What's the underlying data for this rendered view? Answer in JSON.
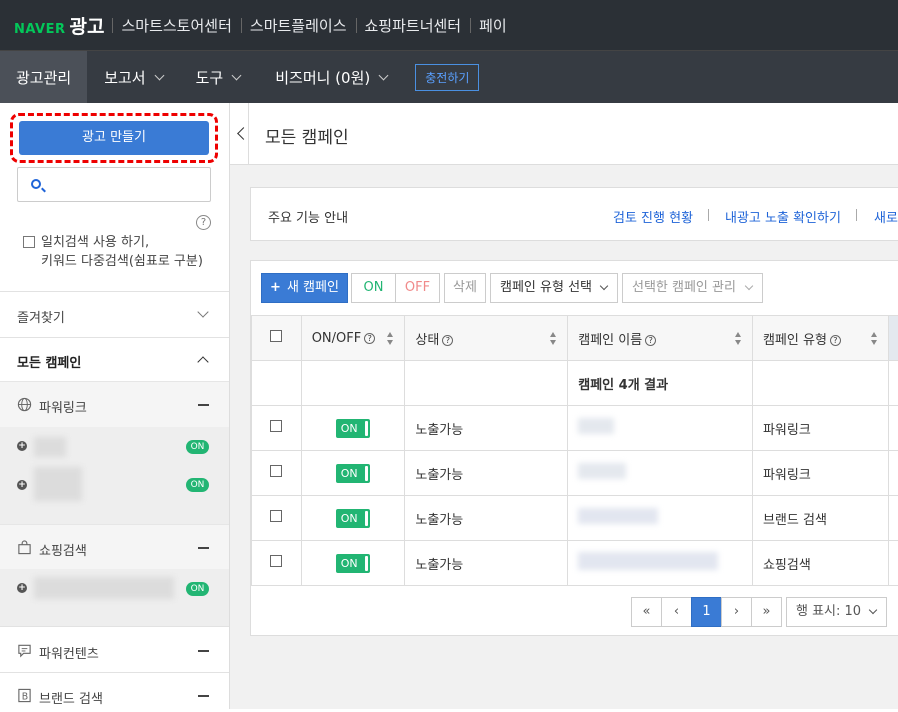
{
  "topbar": {
    "logo_naver": "NAVER",
    "logo_ad": "광고",
    "links": [
      "스마트스토어센터",
      "스마트플레이스",
      "쇼핑파트너센터",
      "페이"
    ]
  },
  "nav": {
    "items": [
      "광고관리",
      "보고서",
      "도구",
      "비즈머니 (0원)"
    ],
    "charge": "충전하기"
  },
  "sidebar": {
    "create_label": "광고 만들기",
    "search_placeholder": "",
    "help": "?",
    "exact_line1": "일치검색 사용 하기,",
    "exact_line2": "키워드 다중검색(쉼표로 구분)",
    "favorites": "즐겨찾기",
    "all_campaigns": "모든 캠페인",
    "groups": [
      {
        "name": "파워링크",
        "icon": "globe-icon"
      },
      {
        "name": "쇼핑검색",
        "icon": "shopping-bag-icon"
      },
      {
        "name": "파워컨텐츠",
        "icon": "chat-icon"
      },
      {
        "name": "브랜드 검색",
        "icon": "brand-b-icon"
      }
    ],
    "on_badge": "ON"
  },
  "main": {
    "title": "모든 캠페인",
    "info": {
      "label": "주요 기능 안내",
      "links": [
        "검토 진행 현황",
        "내광고 노출 확인하기",
        "새로"
      ]
    },
    "toolbar": {
      "new_campaign": "새 캠페인",
      "on": "ON",
      "off": "OFF",
      "delete": "삭제",
      "type_select": "캠페인 유형 선택",
      "manage_select": "선택한 캠페인 관리"
    },
    "table": {
      "headers": [
        "ON/OFF",
        "상태",
        "캠페인 이름",
        "캠페인 유형"
      ],
      "summary": "캠페인 4개 결과",
      "rows": [
        {
          "toggle": "ON",
          "status": "노출가능",
          "type": "파워링크"
        },
        {
          "toggle": "ON",
          "status": "노출가능",
          "type": "파워링크"
        },
        {
          "toggle": "ON",
          "status": "노출가능",
          "type": "브랜드 검색"
        },
        {
          "toggle": "ON",
          "status": "노출가능",
          "type": "쇼핑검색"
        }
      ]
    },
    "pagination": {
      "first": "«",
      "prev": "‹",
      "current": "1",
      "next": "›",
      "last": "»",
      "rows_per_page": "행 표시: 10"
    }
  }
}
